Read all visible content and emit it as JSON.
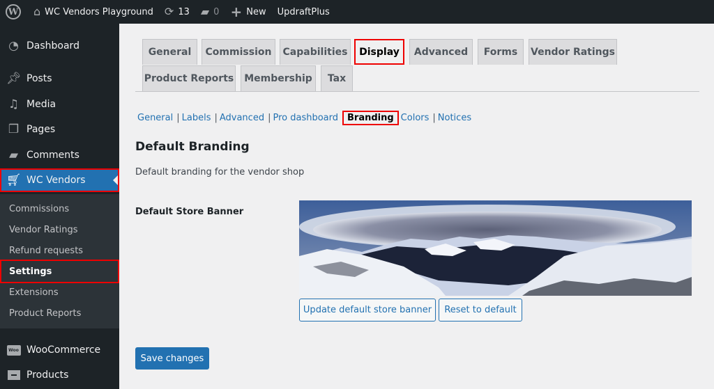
{
  "adminbar": {
    "site_name": "WC Vendors Playground",
    "updates_count": "13",
    "comments_count": "0",
    "new_label": "New",
    "plugin_label": "UpdraftPlus",
    "icons": {
      "wp": "wordpress-logo-icon",
      "home": "home-icon",
      "updates": "refresh-icon",
      "comments": "comment-bubble-icon",
      "new": "plus-icon"
    }
  },
  "sidebar": {
    "items": [
      {
        "label": "Dashboard",
        "icon": "dashboard-gauge-icon"
      },
      {
        "label": "Posts",
        "icon": "pushpin-icon"
      },
      {
        "label": "Media",
        "icon": "media-icon"
      },
      {
        "label": "Pages",
        "icon": "pages-icon"
      },
      {
        "label": "Comments",
        "icon": "comment-bubble-icon"
      },
      {
        "label": "WC Vendors",
        "icon": "cart-icon",
        "active": true
      }
    ],
    "submenu": [
      {
        "label": "Commissions"
      },
      {
        "label": "Vendor Ratings"
      },
      {
        "label": "Refund requests"
      },
      {
        "label": "Settings",
        "current": true
      },
      {
        "label": "Extensions"
      },
      {
        "label": "Product Reports"
      }
    ],
    "bottom_items": [
      {
        "label": "WooCommerce",
        "icon": "woocommerce-icon"
      },
      {
        "label": "Products",
        "icon": "archive-box-icon"
      }
    ]
  },
  "tabs": [
    {
      "label": "General"
    },
    {
      "label": "Commission"
    },
    {
      "label": "Capabilities"
    },
    {
      "label": "Display",
      "active": true
    },
    {
      "label": "Advanced"
    },
    {
      "label": "Forms"
    },
    {
      "label": "Vendor Ratings"
    },
    {
      "label": "Product Reports"
    },
    {
      "label": "Membership"
    },
    {
      "label": "Tax"
    }
  ],
  "subtabs": [
    {
      "label": "General"
    },
    {
      "label": "Labels"
    },
    {
      "label": "Advanced"
    },
    {
      "label": "Pro dashboard"
    },
    {
      "label": "Branding",
      "current": true
    },
    {
      "label": "Colors"
    },
    {
      "label": "Notices"
    }
  ],
  "section": {
    "title": "Default Branding",
    "description": "Default branding for the vendor shop",
    "field_label": "Default Store Banner",
    "banner_alt": "Snowy mountain panorama with lenticular cloud",
    "update_button": "Update default store banner",
    "reset_button": "Reset to default"
  },
  "footer": {
    "save_button": "Save changes"
  },
  "colors": {
    "accent": "#2271b1",
    "highlight_outline": "#e00000",
    "adminbar_bg": "#1d2327",
    "submenu_bg": "#2c3338"
  }
}
